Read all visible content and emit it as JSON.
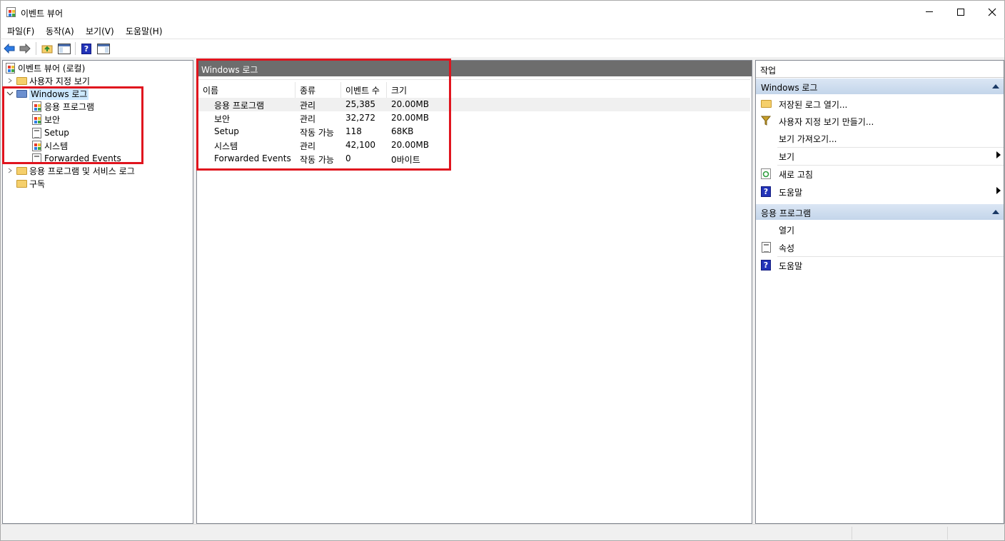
{
  "window": {
    "title": "이벤트 뷰어",
    "controls": {
      "minimize": "—",
      "maximize": "☐",
      "close": "✕"
    }
  },
  "menu": [
    "파일(F)",
    "동작(A)",
    "보기(V)",
    "도움말(H)"
  ],
  "toolbar": {
    "buttons": [
      "back-arrow-icon",
      "forward-arrow-icon",
      "up-folder-icon",
      "show-hide-console-tree-icon",
      "help-icon",
      "show-hide-action-pane-icon"
    ]
  },
  "tree": {
    "root": "이벤트 뷰어 (로컬)",
    "custom_views": "사용자 지정 보기",
    "windows_logs": "Windows 로그",
    "windows_logs_children": [
      "응용 프로그램",
      "보안",
      "Setup",
      "시스템",
      "Forwarded Events"
    ],
    "app_service_logs": "응용 프로그램 및 서비스 로그",
    "subscriptions": "구독"
  },
  "middle": {
    "header": "Windows 로그",
    "columns": [
      "이름",
      "종류",
      "이벤트 수",
      "크기"
    ],
    "rows": [
      {
        "name": "응용 프로그램",
        "type": "관리",
        "count": "25,385",
        "size": "20.00MB"
      },
      {
        "name": "보안",
        "type": "관리",
        "count": "32,272",
        "size": "20.00MB"
      },
      {
        "name": "Setup",
        "type": "작동 가능",
        "count": "118",
        "size": "68KB"
      },
      {
        "name": "시스템",
        "type": "관리",
        "count": "42,100",
        "size": "20.00MB"
      },
      {
        "name": "Forwarded Events",
        "type": "작동 가능",
        "count": "0",
        "size": "0바이트"
      }
    ]
  },
  "actions": {
    "header": "작업",
    "section1": {
      "title": "Windows 로그",
      "items": {
        "open_saved": "저장된 로그 열기...",
        "create_custom": "사용자 지정 보기 만들기...",
        "import_view": "보기 가져오기...",
        "view": "보기",
        "refresh": "새로 고침",
        "help": "도움말"
      }
    },
    "section2": {
      "title": "응용 프로그램",
      "items": {
        "open": "열기",
        "properties": "속성",
        "help": "도움말"
      }
    }
  },
  "colors": {
    "highlight_border": "#e0141e",
    "selection": "#cce8ff",
    "pane_header": "#6d6d6d",
    "section_header": "#c3d5ea"
  }
}
